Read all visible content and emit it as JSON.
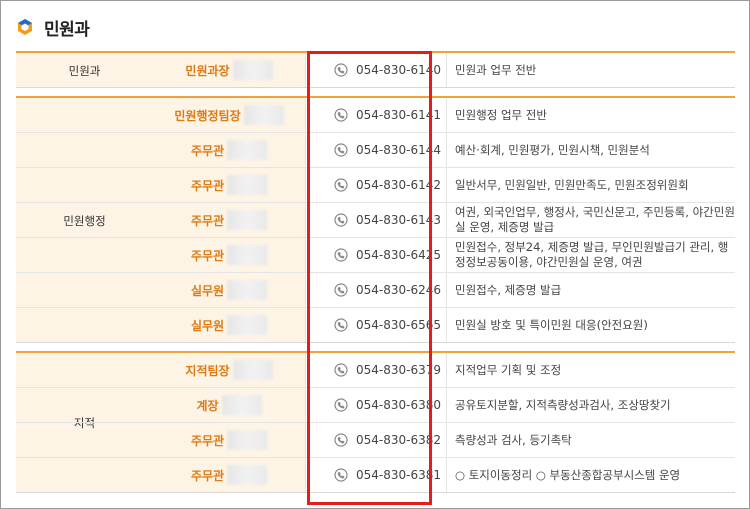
{
  "header": {
    "title": "민원과"
  },
  "sections": [
    {
      "dept": "민원과",
      "rows": [
        {
          "position": "민원과장",
          "phone": "054-830-6140",
          "duty": "민원과 업무 전반"
        }
      ]
    },
    {
      "dept": "민원행정",
      "rows": [
        {
          "position": "민원행정팀장",
          "phone": "054-830-6141",
          "duty": "민원행정 업무 전반"
        },
        {
          "position": "주무관",
          "phone": "054-830-6144",
          "duty": "예산·회계, 민원평가, 민원시책, 민원분석"
        },
        {
          "position": "주무관",
          "phone": "054-830-6142",
          "duty": "일반서무, 민원일반, 민원만족도, 민원조정위원회"
        },
        {
          "position": "주무관",
          "phone": "054-830-6143",
          "duty": "여권, 외국인업무, 행정사, 국민신문고, 주민등록, 야간민원실 운영, 제증명 발급"
        },
        {
          "position": "주무관",
          "phone": "054-830-6425",
          "duty": "민원접수, 정부24, 제증명 발급, 무인민원발급기 관리, 행정정보공동이용, 야간민원실 운영, 여권"
        },
        {
          "position": "실무원",
          "phone": "054-830-6246",
          "duty": "민원접수, 제증명 발급"
        },
        {
          "position": "실무원",
          "phone": "054-830-6565",
          "duty": "민원실 방호 및 특이민원 대응(안전요원)"
        }
      ]
    },
    {
      "dept": "지적",
      "rows": [
        {
          "position": "지적팀장",
          "phone": "054-830-6379",
          "duty": "지적업무 기획 및 조정"
        },
        {
          "position": "계장",
          "phone": "054-830-6380",
          "duty": "공유토지분할, 지적측량성과검사, 조상땅찾기"
        },
        {
          "position": "주무관",
          "phone": "054-830-6382",
          "duty": "측량성과 검사, 등기촉탁"
        },
        {
          "position": "주무관",
          "phone": "054-830-6381",
          "duty": "○ 토지이동정리 ○ 부동산종합공부시스템 운영"
        }
      ]
    }
  ],
  "colors": {
    "accent": "#f0a23b",
    "position_text": "#e07912",
    "highlight": "#e51c1c",
    "dept_bg": "#fdf4e6"
  },
  "icons": {
    "logo": "hexagon-logo-icon",
    "phone": "phone-icon"
  }
}
